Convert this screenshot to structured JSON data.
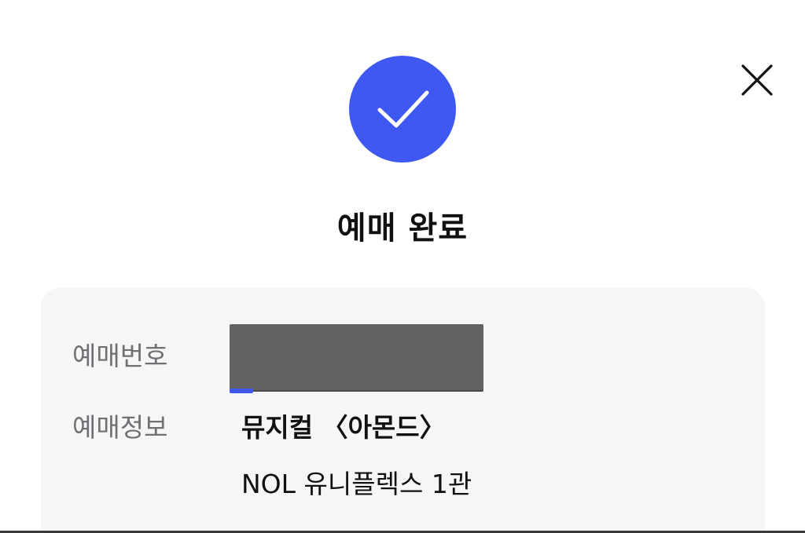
{
  "header": {
    "close_icon": "close-icon",
    "success_icon": "check-icon",
    "accent_color": "#3f58f2"
  },
  "main": {
    "title": "예매 완료"
  },
  "details": {
    "booking_number_label": "예매번호",
    "booking_number_value": "",
    "booking_info_label": "예매정보",
    "show_title": "뮤지컬 〈아몬드〉",
    "venue": "NOL 유니플렉스 1관"
  }
}
